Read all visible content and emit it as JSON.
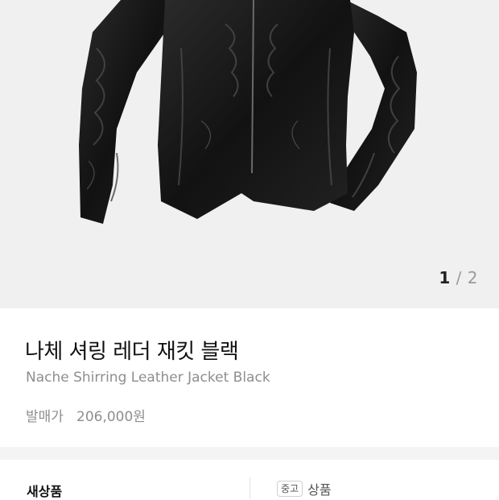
{
  "gallery": {
    "current_page": "1",
    "separator": "/",
    "total_pages": "2",
    "image_label": "black-leather-jacket"
  },
  "product": {
    "title": "나체 셔링 레더 재킷 블랙",
    "subtitle": "Nache Shirring Leather Jacket Black",
    "price_label": "발매가",
    "price_value": "206,000원"
  },
  "tabs": {
    "new_label": "새상품",
    "used_badge": "중고",
    "used_label": "상품"
  },
  "colors": {
    "gallery_bg": "#f0f0f0",
    "jacket": "#151515",
    "muted_text": "#8e8e8e"
  }
}
